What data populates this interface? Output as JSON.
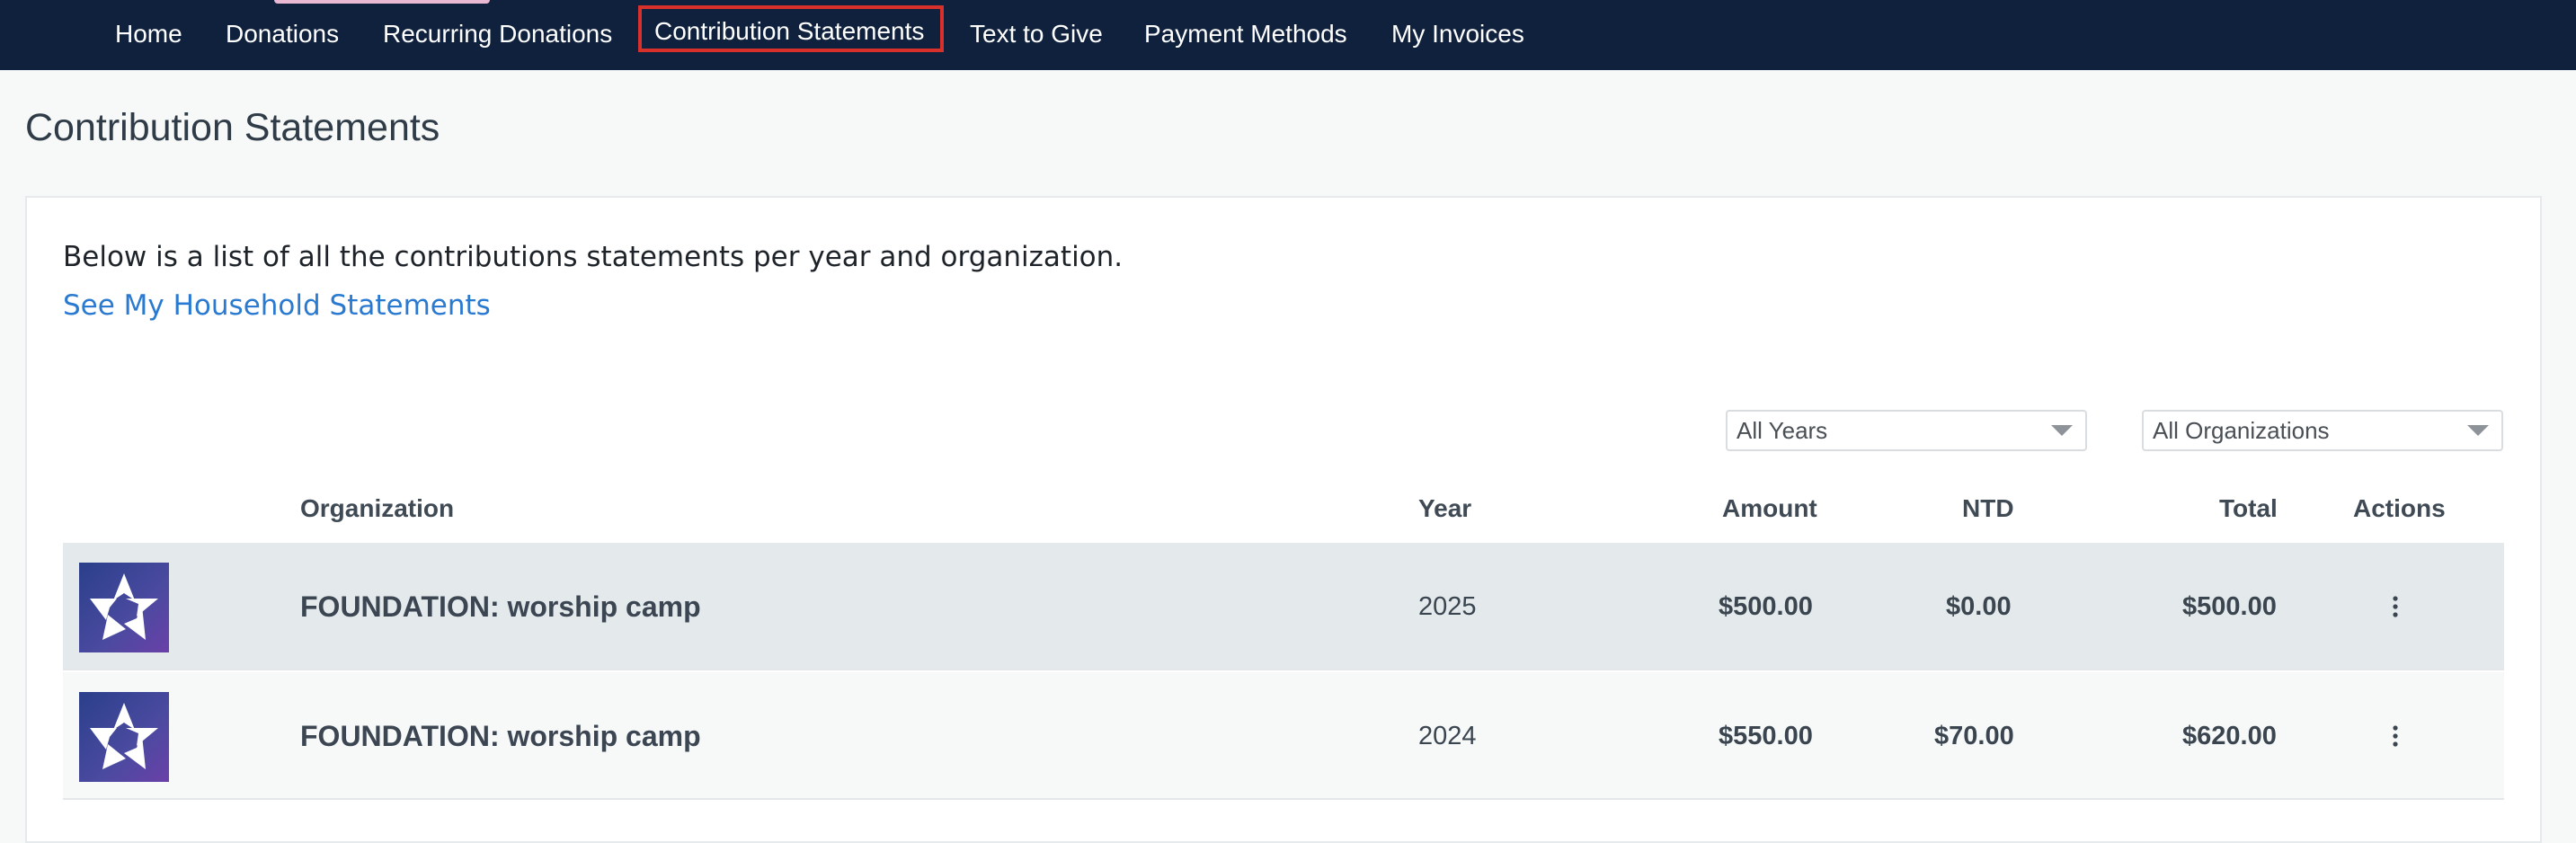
{
  "nav": {
    "items": [
      {
        "label": "Home"
      },
      {
        "label": "Donations"
      },
      {
        "label": "Recurring Donations"
      },
      {
        "label": "Contribution Statements",
        "active": true
      },
      {
        "label": "Text to Give"
      },
      {
        "label": "Payment Methods"
      },
      {
        "label": "My Invoices"
      }
    ]
  },
  "page": {
    "title": "Contribution Statements",
    "intro": "Below is a list of all the contributions statements per year and organization.",
    "household_link": "See My Household Statements"
  },
  "filters": {
    "years": "All Years",
    "organizations": "All Organizations"
  },
  "table": {
    "headers": {
      "organization": "Organization",
      "year": "Year",
      "amount": "Amount",
      "ntd": "NTD",
      "total": "Total",
      "actions": "Actions"
    },
    "rows": [
      {
        "organization": "FOUNDATION: worship camp",
        "year": "2025",
        "amount": "$500.00",
        "ntd": "$0.00",
        "total": "$500.00"
      },
      {
        "organization": "FOUNDATION: worship camp",
        "year": "2024",
        "amount": "$550.00",
        "ntd": "$70.00",
        "total": "$620.00"
      }
    ]
  },
  "icons": {
    "logo": "organization-logo-icon",
    "actions": "kebab-menu-icon",
    "dropdown": "caret-down-icon"
  },
  "colors": {
    "nav_background": "#0f213d",
    "active_outline": "#d8302a",
    "link": "#2a7ad1",
    "selected_row": "#e4eaec"
  }
}
